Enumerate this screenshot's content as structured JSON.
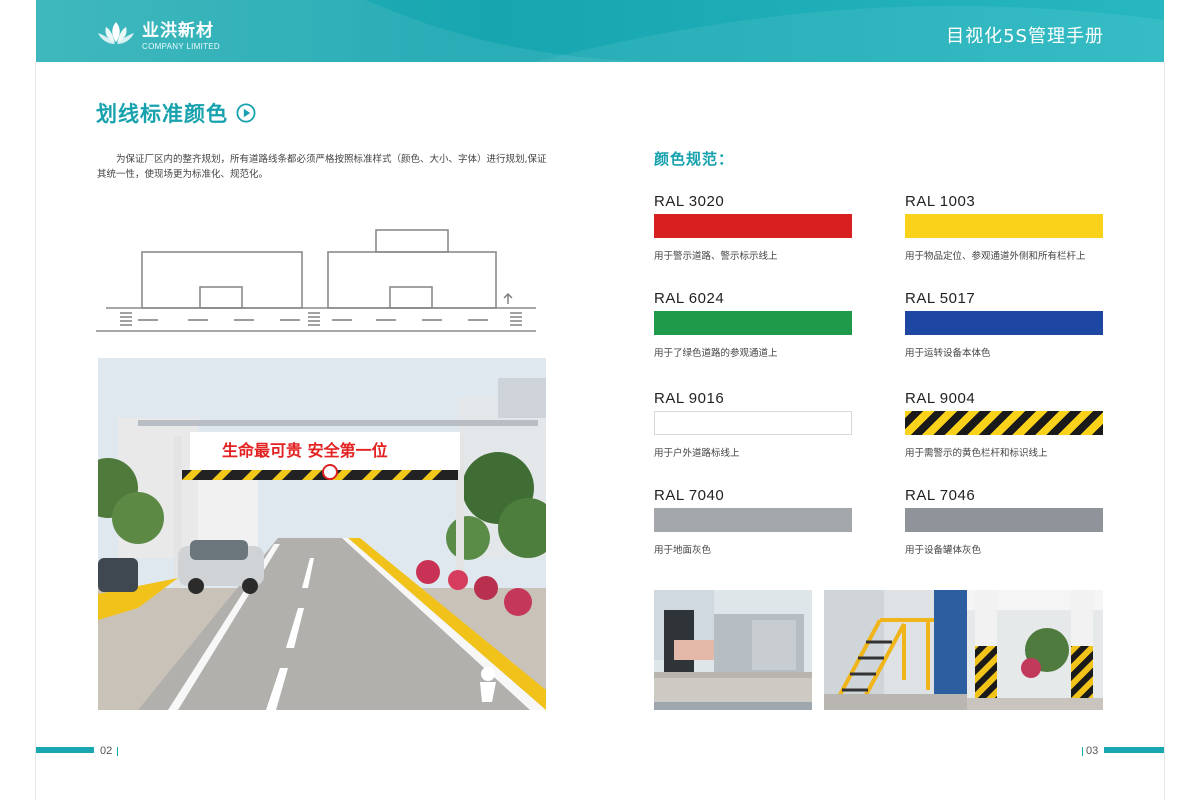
{
  "header": {
    "brand_cn": "业洪新材",
    "brand_en": "COMPANY LIMITED",
    "title": "目视化5S管理手册",
    "color": "#1aa9b3"
  },
  "left_page": {
    "section_title": "划线标准颜色",
    "intro": "为保证厂区内的整齐规划，所有道路线条都必须严格按照标准样式（颜色、大小、字体）进行规划,保证其统一性，使现场更为标准化、规范化。",
    "photo_banner": "生命最可贵  安全第一位",
    "page_number": "02"
  },
  "right_page": {
    "color_title": "颜色规范：",
    "swatches": [
      {
        "code": "RAL 3020",
        "color": "#d7201f",
        "desc": "用于警示道路、警示标示线上"
      },
      {
        "code": "RAL 1003",
        "color": "#fad21a",
        "desc": "用于物品定位、参观通道外侧和所有栏杆上"
      },
      {
        "code": "RAL 6024",
        "color": "#1e9a4a",
        "desc": "用于了绿色道路的参观通道上"
      },
      {
        "code": "RAL 5017",
        "color": "#1d47a3",
        "desc": "用于运转设备本体色"
      },
      {
        "code": "RAL 9016",
        "color": "#ffffff",
        "desc": "用于户外道路标线上"
      },
      {
        "code": "RAL 9004",
        "color": "#fad21a",
        "desc": "用于需警示的黄色栏杆和标识线上"
      },
      {
        "code": "RAL 7040",
        "color": "#a4a8ad",
        "desc": "用于地面灰色"
      },
      {
        "code": "RAL 7046",
        "color": "#8f949a",
        "desc": "用于设备罐体灰色"
      }
    ],
    "page_number": "03"
  }
}
